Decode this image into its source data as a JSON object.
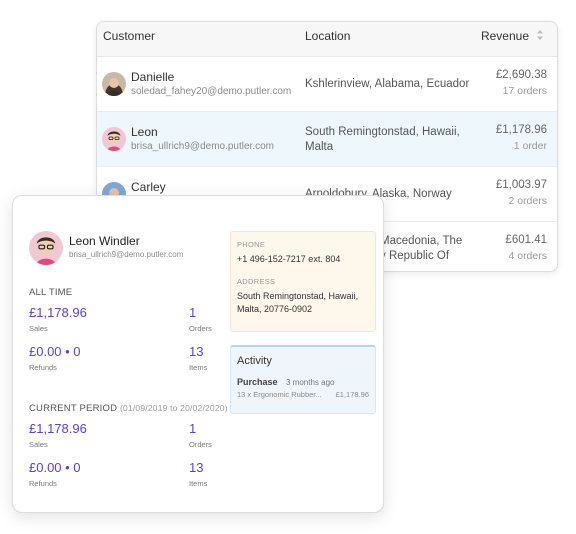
{
  "table": {
    "columns": {
      "customer": "Customer",
      "location": "Location",
      "revenue": "Revenue"
    },
    "rows": [
      {
        "name": "Danielle",
        "email": "soledad_fahey20@demo.putler.com",
        "location": "Kshlerinview, Alabama, Ecuador",
        "revenue": "£2,690.38",
        "orders": "17 orders",
        "selected": false
      },
      {
        "name": "Leon",
        "email": "brisa_ullrich9@demo.putler.com",
        "location": "South Remingtonstad, Hawaii, Malta",
        "revenue": "£1,178.96",
        "orders": "1 order",
        "selected": true
      },
      {
        "name": "Carley",
        "email": "",
        "location": "Arnoldobury, Alaska, Norway",
        "revenue": "£1,003.97",
        "orders": "2 orders",
        "selected": false
      },
      {
        "name": "",
        "email": "",
        "location": "Macedonia, The",
        "location_line2": "y Republic Of",
        "revenue": "£601.41",
        "orders": "4 orders",
        "selected": false
      }
    ]
  },
  "profile": {
    "name": "Leon Windler",
    "email": "brisa_ullrich9@demo.putler.com",
    "all_time": {
      "title": "ALL TIME",
      "sales_value": "£1,178.96",
      "sales_label": "Sales",
      "orders_value": "1",
      "orders_label": "Orders",
      "refunds_value": "£0.00 • 0",
      "refunds_label": "Refunds",
      "items_value": "13",
      "items_label": "Items"
    },
    "current_period": {
      "title": "CURRENT PERIOD",
      "range": "(01/09/2019 to 20/02/2020)",
      "sales_value": "£1,178.96",
      "sales_label": "Sales",
      "orders_value": "1",
      "orders_label": "Orders",
      "refunds_value": "£0.00 • 0",
      "refunds_label": "Refunds",
      "items_value": "13",
      "items_label": "Items"
    },
    "contact": {
      "phone_label": "PHONE",
      "phone": "+1 496-152-7217 ext. 804",
      "address_label": "ADDRESS",
      "address": "South Remingtonstad, Hawaii, Malta, 20776-0902"
    },
    "activity": {
      "title": "Activity",
      "event": "Purchase",
      "time": "3 months ago",
      "item": "13 x Ergonomic Rubber...",
      "amount": "£1,178.96"
    }
  },
  "colors": {
    "accent": "#5b3fd6",
    "selected_row": "#eef7fb",
    "contact_bg": "#fdf7ec",
    "activity_bg": "#eef6fc"
  }
}
